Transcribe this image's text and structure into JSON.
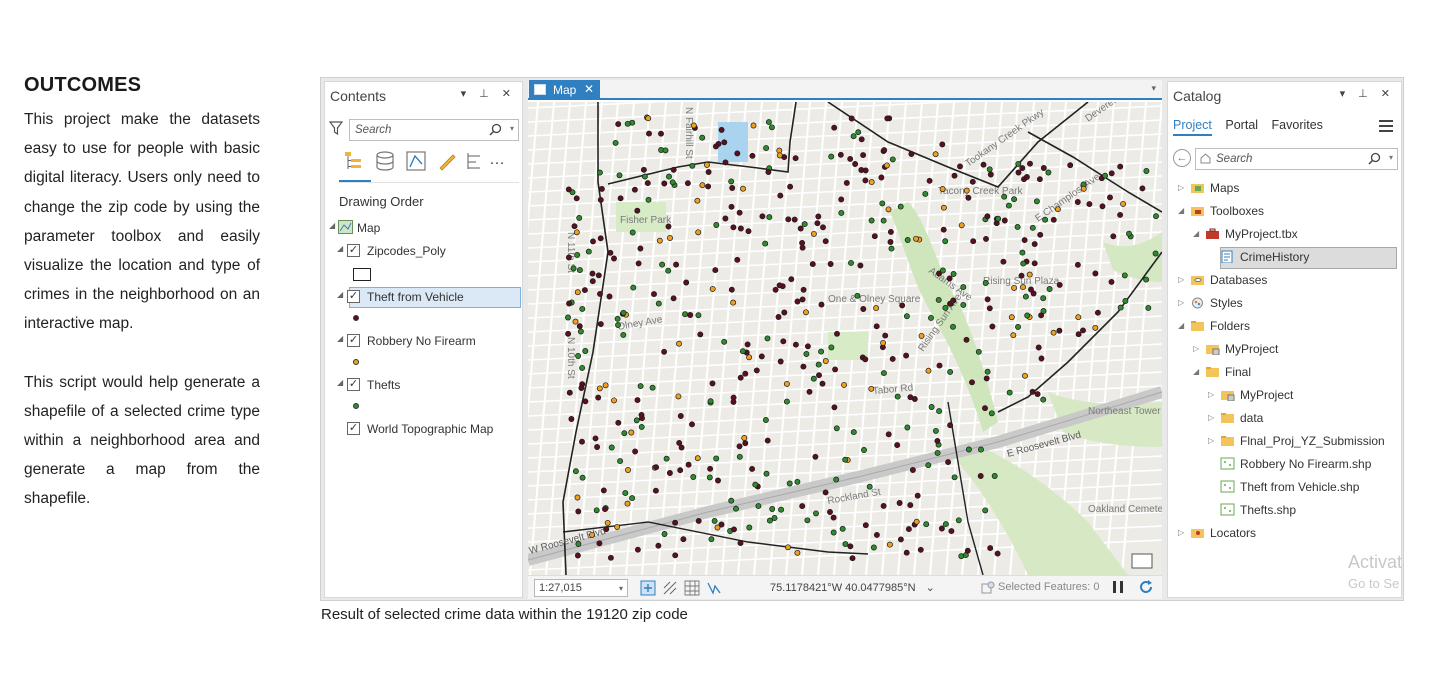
{
  "outcomes": {
    "heading": "OUTCOMES",
    "paragraph1": "This project make the datasets easy to use for people with basic digital literacy. Users only need to change the zip code by using the parameter toolbox and easily visualize the location and type of crimes in the neighborhood on an interactive map.",
    "paragraph2": "This script would help generate a shapefile of a selected crime type within a neighborhood area and generate a map from the shapefile."
  },
  "caption": "Result of selected crime data within the 19120 zip code",
  "contents_pane": {
    "title": "Contents",
    "search_placeholder": "Search",
    "drawing_order": "Drawing Order",
    "layers": [
      {
        "label": "Map",
        "icon": "map-icon"
      },
      {
        "label": "Zipcodes_Poly",
        "checked": true
      },
      {
        "label": "Theft from Vehicle",
        "checked": true,
        "selected": true,
        "symbol_color": "#5a1020"
      },
      {
        "label": "Robbery No Firearm",
        "checked": true,
        "symbol_color": "#f0a020"
      },
      {
        "label": "Thefts",
        "checked": true,
        "symbol_color": "#2e8b2e"
      },
      {
        "label": "World Topographic Map",
        "checked": true
      }
    ]
  },
  "map_pane": {
    "tab_label": "Map",
    "scale": "1:27,015",
    "coordinates": "75.1178421°W 40.0477985°N",
    "selected_features": "Selected Features: 0",
    "place_labels": [
      "Fisher Park",
      "Tacony Creek Park",
      "One & Olney Square",
      "Rising Sun Plaza",
      "Northeast Tower Center",
      "Oakland Cemetery",
      "E Roosevelt Blvd",
      "W Roosevelt Blvd",
      "Tookany Creek Pkwy",
      "E Champlost Ave",
      "Adams Ave",
      "Rising Sun Ave",
      "Tabor Rd",
      "Rockland St",
      "N 11th St",
      "N 10th St",
      "N Fairhill St",
      "Devereaux Ave",
      "Olney Ave"
    ]
  },
  "catalog_pane": {
    "title": "Catalog",
    "tabs": [
      "Project",
      "Portal",
      "Favorites"
    ],
    "active_tab": "Project",
    "search_placeholder": "Search",
    "tree": [
      {
        "label": "Maps",
        "icon": "maps-folder-icon"
      },
      {
        "label": "Toolboxes",
        "icon": "toolboxes-folder-icon"
      },
      {
        "label": "MyProject.tbx",
        "icon": "toolbox-icon"
      },
      {
        "label": "CrimeHistory",
        "icon": "script-tool-icon",
        "selected": true
      },
      {
        "label": "Databases",
        "icon": "databases-folder-icon"
      },
      {
        "label": "Styles",
        "icon": "styles-folder-icon"
      },
      {
        "label": "Folders",
        "icon": "folders-folder-icon"
      },
      {
        "label": "MyProject",
        "icon": "folder-connection-icon"
      },
      {
        "label": "Final",
        "icon": "folder-icon"
      },
      {
        "label": "MyProject",
        "icon": "folder-connection-icon"
      },
      {
        "label": "data",
        "icon": "folder-icon"
      },
      {
        "label": "Flnal_Proj_YZ_Submission",
        "icon": "folder-icon"
      },
      {
        "label": "Robbery No Firearm.shp",
        "icon": "shapefile-icon"
      },
      {
        "label": "Theft from Vehicle.shp",
        "icon": "shapefile-icon"
      },
      {
        "label": "Thefts.shp",
        "icon": "shapefile-icon"
      },
      {
        "label": "Locators",
        "icon": "locators-folder-icon"
      }
    ],
    "watermark_line1": "Activat",
    "watermark_line2": "Go to Se"
  },
  "colors": {
    "accent": "#2f7fc1",
    "theft_from_vehicle": "#5a1020",
    "robbery_no_firearm": "#f0a020",
    "thefts": "#2e8b2e"
  }
}
